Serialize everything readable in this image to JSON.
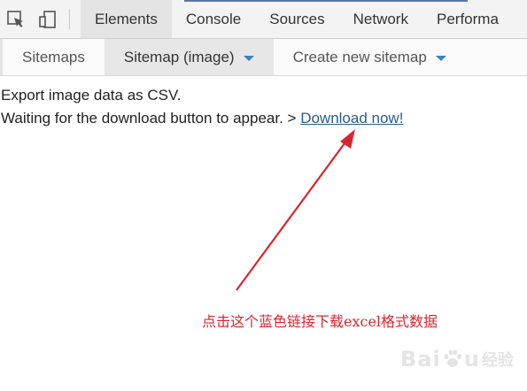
{
  "devtools": {
    "tabs": [
      {
        "label": "Elements",
        "active": true
      },
      {
        "label": "Console",
        "active": false
      },
      {
        "label": "Sources",
        "active": false
      },
      {
        "label": "Network",
        "active": false
      },
      {
        "label": "Performa",
        "active": false
      }
    ],
    "icons": [
      "inspect-element-icon",
      "device-toolbar-icon"
    ]
  },
  "sitemap_nav": {
    "items": [
      {
        "label": "Sitemaps",
        "active": false,
        "dropdown": false
      },
      {
        "label": "Sitemap (image)",
        "active": true,
        "dropdown": true
      },
      {
        "label": "Create new sitemap",
        "active": false,
        "dropdown": true
      }
    ]
  },
  "content": {
    "line1": "Export image data as CSV.",
    "line2_prefix": "Waiting for the download button to appear. > ",
    "download_link": "Download now!"
  },
  "annotation": {
    "text": "点击这个蓝色链接下载excel格式数据",
    "color": "#d9262e"
  },
  "watermark": {
    "brand_a": "Bai",
    "brand_b": "u",
    "suffix": "经验"
  },
  "colors": {
    "link": "#2b5d8c",
    "caret": "#3b82c4",
    "arrow": "#d9262e",
    "top_accent": "#5a78a8"
  }
}
